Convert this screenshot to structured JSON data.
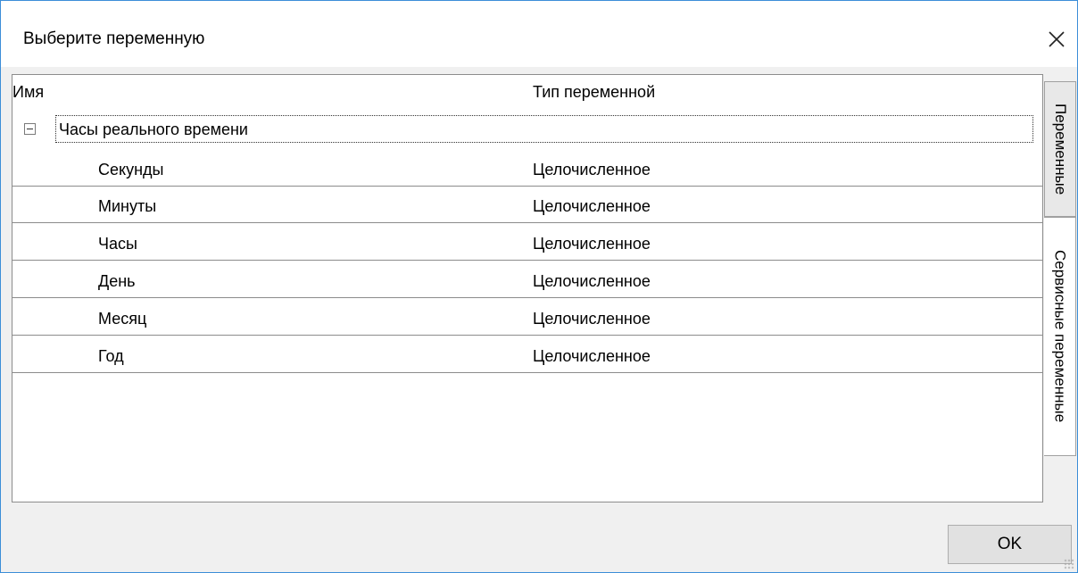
{
  "window": {
    "title": "Выберите переменную",
    "close_icon": "close-icon"
  },
  "tree": {
    "columns": {
      "name": "Имя",
      "type": "Тип переменной"
    },
    "group": {
      "label": "Часы реального времени",
      "expanded": true
    },
    "rows": [
      {
        "name": "Секунды",
        "type": "Целочисленное"
      },
      {
        "name": "Минуты",
        "type": "Целочисленное"
      },
      {
        "name": "Часы",
        "type": "Целочисленное"
      },
      {
        "name": "День",
        "type": "Целочисленное"
      },
      {
        "name": "Месяц",
        "type": "Целочисленное"
      },
      {
        "name": "Год",
        "type": "Целочисленное"
      }
    ]
  },
  "side_tabs": {
    "variables": "Переменные",
    "service_variables": "Сервисные переменные",
    "active": "service_variables"
  },
  "buttons": {
    "ok": "OK"
  },
  "colors": {
    "window_border": "#3c8ed8",
    "panel_background": "#f0f0f0",
    "row_divider": "#8c8c8c"
  }
}
